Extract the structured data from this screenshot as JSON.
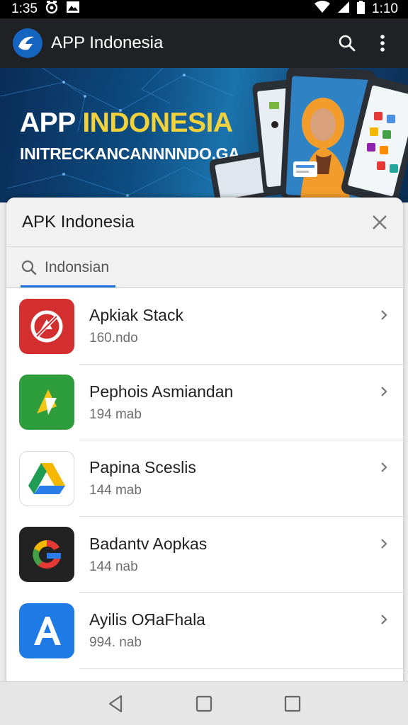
{
  "status_bar": {
    "time_left": "1:35",
    "time_right": "1:10"
  },
  "app_bar": {
    "title": "APP Indonesia",
    "icons": [
      "app-logo-icon",
      "search-icon",
      "more-vert-icon"
    ]
  },
  "banner": {
    "title_white": "APP ",
    "title_yellow": "INDONESIA",
    "subtitle": "INITRECKANCANNNNDO.GA"
  },
  "sheet": {
    "title": "APK Indonesia",
    "search_value": "Indonsian",
    "accent_color": "#1e6fd9",
    "items": [
      {
        "name": "Apkiak Stack",
        "meta": "160.ndo",
        "icon": "red-slash-icon",
        "color": "#d32f2f"
      },
      {
        "name": "Pephois Asmiandan",
        "meta": "194 mab",
        "icon": "green-yellow-arrow-icon",
        "color": "#2e9d3c"
      },
      {
        "name": "Papina Sceslis",
        "meta": "144 mab",
        "icon": "drive-triangle-icon",
        "color": "#ffffff"
      },
      {
        "name": "Badantv Aopkas",
        "meta": "144 nab",
        "icon": "g-logo-icon",
        "color": "#222222"
      },
      {
        "name": "Ayilis ОЯaFhala",
        "meta": "994. nab",
        "icon": "letter-a-icon",
        "color": "#1e7be6"
      }
    ]
  },
  "nav_bar": {
    "buttons": [
      "back-icon",
      "home-icon",
      "recents-icon"
    ]
  }
}
